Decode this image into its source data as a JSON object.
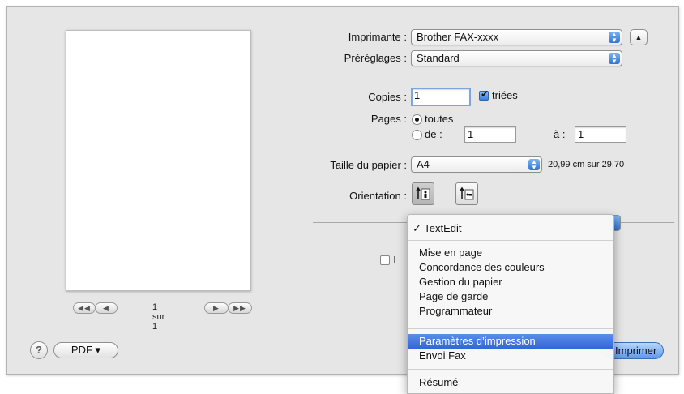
{
  "pager": {
    "label": "1 sur 1"
  },
  "printer": {
    "label": "Imprimante :",
    "value": "Brother FAX-xxxx"
  },
  "presets": {
    "label": "Préréglages :",
    "value": "Standard"
  },
  "copies": {
    "label": "Copies :",
    "value": "1",
    "collated_label": "triées",
    "collated": true
  },
  "pages": {
    "label": "Pages :",
    "all_label": "toutes",
    "from_label": "de :",
    "from_value": "1",
    "to_label": "à :",
    "to_value": "1",
    "selected": "toutes"
  },
  "paper_size": {
    "label": "Taille du papier :",
    "value": "A4",
    "dimensions": "20,99 cm sur 29,70"
  },
  "orientation": {
    "label": "Orientation :",
    "selected": "portrait"
  },
  "footer": {
    "pdf_label": "PDF ▾",
    "help_label": "?",
    "print_label": "Imprimer"
  },
  "menu": {
    "checked_item": "TextEdit",
    "items_group1": [
      "Mise en page",
      "Concordance des couleurs",
      "Gestion du papier",
      "Page de garde",
      "Programmateur"
    ],
    "selected_item": "Paramètres d’impression",
    "fax_item": "Envoi Fax",
    "summary_item": "Résumé"
  },
  "colors": {
    "selection": "#3266d6",
    "accent": "#2f75d6"
  }
}
